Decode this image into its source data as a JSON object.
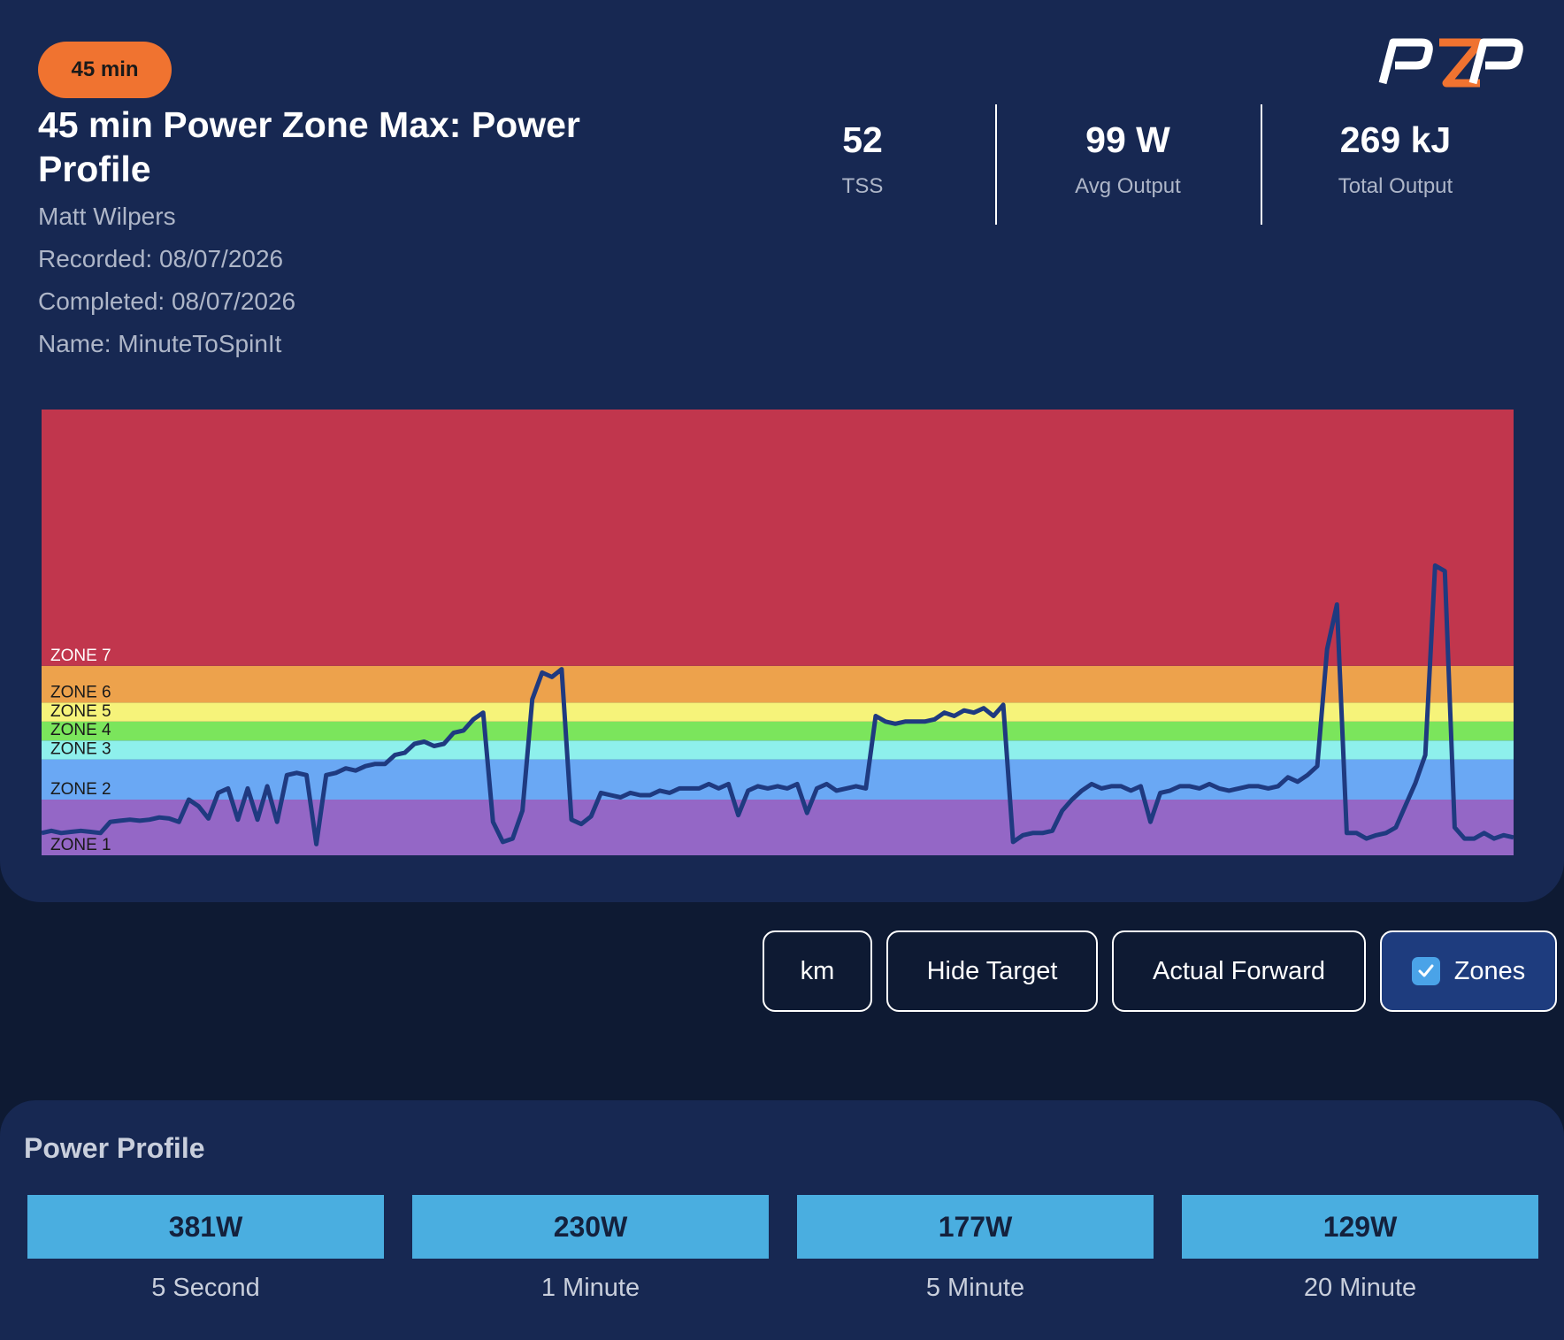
{
  "workout": {
    "badge": "45 min",
    "title": "45 min Power Zone Max: Power Profile",
    "instructor": "Matt Wilpers",
    "recorded": "Recorded: 08/07/2026",
    "completed": "Completed: 08/07/2026",
    "name": "Name: MinuteToSpinIt"
  },
  "stats": [
    {
      "value": "52",
      "label": "TSS"
    },
    {
      "value": "99 W",
      "label": "Avg Output"
    },
    {
      "value": "269 kJ",
      "label": "Total Output"
    }
  ],
  "buttons": {
    "km": "km",
    "hide_target": "Hide Target",
    "actual_forward": "Actual Forward",
    "zones": "Zones",
    "zones_checked": true
  },
  "power_profile": {
    "title": "Power Profile",
    "items": [
      {
        "value": "381W",
        "label": "5 Second"
      },
      {
        "value": "230W",
        "label": "1 Minute"
      },
      {
        "value": "177W",
        "label": "5 Minute"
      },
      {
        "value": "129W",
        "label": "20 Minute"
      }
    ]
  },
  "colors": {
    "accent_orange": "#f07330",
    "card_bg": "#172852",
    "page_bg": "#0e1a33",
    "power_line": "#1f3a80"
  },
  "chart_data": {
    "type": "line",
    "title": "",
    "xlabel": "",
    "ylabel": "",
    "xlim": [
      0,
      45
    ],
    "ylim": [
      0,
      400
    ],
    "grid": false,
    "zones": [
      {
        "name": "ZONE 1",
        "from": 0,
        "to": 50,
        "color": "#9467c6"
      },
      {
        "name": "ZONE 2",
        "from": 50,
        "to": 86,
        "color": "#6aa8f4"
      },
      {
        "name": "ZONE 3",
        "from": 86,
        "to": 103,
        "color": "#8ef0ec"
      },
      {
        "name": "ZONE 4",
        "from": 103,
        "to": 120,
        "color": "#7be55c"
      },
      {
        "name": "ZONE 5",
        "from": 120,
        "to": 137,
        "color": "#f6f37a"
      },
      {
        "name": "ZONE 6",
        "from": 137,
        "to": 170,
        "color": "#eda24c"
      },
      {
        "name": "ZONE 7",
        "from": 170,
        "to": 400,
        "color": "#c1364d"
      }
    ],
    "series": [
      {
        "x": [
          0,
          0.3,
          0.6,
          0.9,
          1.2,
          1.5,
          1.8,
          2.1,
          2.4,
          2.7,
          3.0,
          3.3,
          3.6,
          3.9,
          4.2,
          4.5,
          4.8,
          5.1,
          5.4,
          5.7,
          6.0,
          6.3,
          6.6,
          6.9,
          7.2,
          7.5,
          7.8,
          8.1,
          8.4,
          8.7,
          9.0,
          9.3,
          9.6,
          9.9,
          10.2,
          10.5,
          10.8,
          11.1,
          11.4,
          11.7,
          12.0,
          12.3,
          12.6,
          12.9,
          13.2,
          13.5,
          13.8,
          14.1,
          14.4,
          14.7,
          15.0,
          15.3,
          15.6,
          15.9,
          16.2,
          16.5,
          16.8,
          17.1,
          17.4,
          17.7,
          18.0,
          18.3,
          18.6,
          18.9,
          19.2,
          19.5,
          19.8,
          20.1,
          20.4,
          20.7,
          21.0,
          21.3,
          21.6,
          21.9,
          22.2,
          22.5,
          22.8,
          23.1,
          23.4,
          23.7,
          24.0,
          24.3,
          24.6,
          24.9,
          25.2,
          25.5,
          25.8,
          26.1,
          26.4,
          26.7,
          27.0,
          27.3,
          27.6,
          27.9,
          28.2,
          28.5,
          28.8,
          29.1,
          29.4,
          29.7,
          30.0,
          30.3,
          30.6,
          30.9,
          31.2,
          31.5,
          31.8,
          32.1,
          32.4,
          32.7,
          33.0,
          33.3,
          33.6,
          33.9,
          34.2,
          34.5,
          34.8,
          35.1,
          35.4,
          35.7,
          36.0,
          36.3,
          36.6,
          36.9,
          37.2,
          37.5,
          37.8,
          38.1,
          38.4,
          38.7,
          39.0,
          39.3,
          39.6,
          39.9,
          40.2,
          40.5,
          40.8,
          41.1,
          41.4,
          41.7,
          42.0,
          42.3,
          42.6,
          42.9,
          43.2,
          43.5,
          43.8,
          44.1,
          44.4,
          44.7,
          45.0
        ],
        "y": [
          20,
          22,
          20,
          21,
          22,
          21,
          20,
          30,
          31,
          32,
          31,
          32,
          34,
          33,
          30,
          50,
          44,
          33,
          56,
          60,
          32,
          60,
          32,
          62,
          30,
          72,
          74,
          72,
          10,
          72,
          74,
          78,
          76,
          80,
          82,
          82,
          90,
          92,
          100,
          102,
          98,
          100,
          110,
          112,
          122,
          128,
          30,
          12,
          15,
          40,
          140,
          164,
          160,
          167,
          32,
          28,
          35,
          56,
          54,
          52,
          56,
          54,
          54,
          58,
          56,
          60,
          60,
          60,
          64,
          60,
          64,
          36,
          58,
          62,
          60,
          62,
          60,
          64,
          38,
          60,
          64,
          58,
          60,
          62,
          60,
          125,
          120,
          118,
          120,
          120,
          120,
          122,
          128,
          125,
          130,
          128,
          132,
          125,
          135,
          12,
          18,
          20,
          20,
          22,
          40,
          50,
          58,
          64,
          60,
          62,
          62,
          58,
          62,
          30,
          56,
          58,
          62,
          62,
          60,
          64,
          60,
          58,
          60,
          62,
          62,
          60,
          62,
          70,
          66,
          72,
          80,
          185,
          225,
          20,
          20,
          15,
          18,
          20,
          25,
          45,
          65,
          90,
          260,
          255,
          25,
          15,
          15,
          20,
          15,
          18,
          16
        ]
      }
    ]
  }
}
